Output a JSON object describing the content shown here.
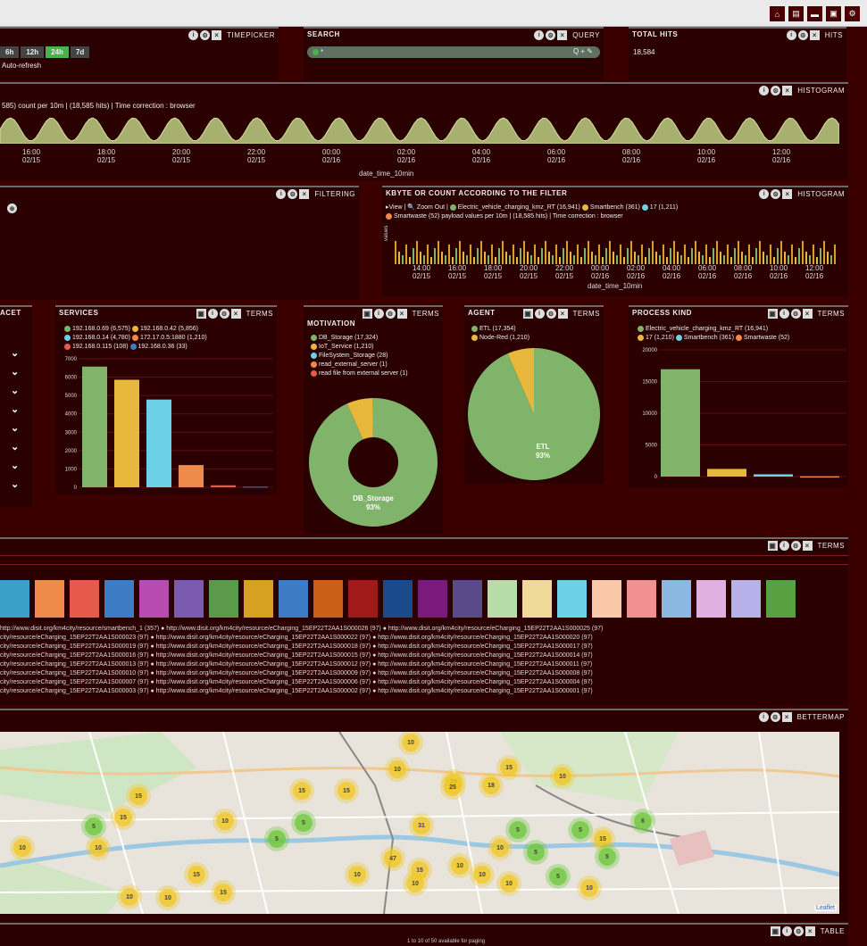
{
  "timepicker": {
    "title": "TIMEPICKER",
    "buttons": [
      "6h",
      "12h",
      "24h",
      "7d"
    ],
    "active": "24h",
    "autorefresh": "Auto-refresh"
  },
  "search": {
    "title": "SEARCH",
    "query_label": "QUERY",
    "value": "*",
    "icons": "Q + ✎"
  },
  "total_hits": {
    "title": "TOTAL HITS",
    "value": "18,584",
    "badge": "HITS"
  },
  "histogram1": {
    "badge": "HISTOGRAM",
    "caption": "585) count per 10m | (18,585 hits) | Time correction : browser",
    "xlabel": "date_time_10min",
    "ticks": [
      [
        "16:00",
        "02/15"
      ],
      [
        "18:00",
        "02/15"
      ],
      [
        "20:00",
        "02/15"
      ],
      [
        "22:00",
        "02/15"
      ],
      [
        "00:00",
        "02/16"
      ],
      [
        "02:00",
        "02/16"
      ],
      [
        "04:00",
        "02/16"
      ],
      [
        "06:00",
        "02/16"
      ],
      [
        "08:00",
        "02/16"
      ],
      [
        "10:00",
        "02/16"
      ],
      [
        "12:00",
        "02/16"
      ]
    ]
  },
  "filtering": {
    "badge": "FILTERING"
  },
  "histogram2": {
    "title": "KBYTE OR COUNT ACCORDING TO THE FILTER",
    "badge": "HISTOGRAM",
    "view": "▸View | 🔍 Zoom Out |",
    "legend1": "Electric_vehicle_charging_kmz_RT (16,941)",
    "legend2": "Smartbench (361)",
    "legend3": "17 (1,211)",
    "legend4": "Smartwaste (52)",
    "caption": "payload values per 10m | (18,585 hits) | Time correction : browser",
    "xlabel": "date_time_10min",
    "ylabel": "values",
    "ticks": [
      [
        "14:00",
        "02/15"
      ],
      [
        "16:00",
        "02/15"
      ],
      [
        "18:00",
        "02/15"
      ],
      [
        "20:00",
        "02/15"
      ],
      [
        "22:00",
        "02/15"
      ],
      [
        "00:00",
        "02/16"
      ],
      [
        "02:00",
        "02/16"
      ],
      [
        "04:00",
        "02/16"
      ],
      [
        "06:00",
        "02/16"
      ],
      [
        "08:00",
        "02/16"
      ],
      [
        "10:00",
        "02/16"
      ],
      [
        "12:00",
        "02/16"
      ]
    ]
  },
  "facet": {
    "title": "ACET"
  },
  "services": {
    "title": "SERVICES",
    "badge": "TERMS",
    "legend": [
      {
        "label": "192.168.0.69 (6,575)",
        "color": "#7fb46a"
      },
      {
        "label": "192.168.0.42 (5,856)",
        "color": "#e8b83c"
      },
      {
        "label": "192.168.0.14 (4,780)",
        "color": "#6cd0e6"
      },
      {
        "label": "172.17.0.5:1880 (1,210)",
        "color": "#ef8a4a"
      },
      {
        "label": "192.168.0.115 (108)",
        "color": "#e55a4a"
      },
      {
        "label": "192.168.0.36 (33)",
        "color": "#3d7bc4"
      }
    ],
    "yticks": [
      "7000",
      "6000",
      "5000",
      "4000",
      "3000",
      "2000",
      "1000",
      "0"
    ]
  },
  "motivation": {
    "title": "MOTIVATION",
    "badge": "TERMS",
    "legend": [
      {
        "label": "DB_Storage (17,324)",
        "color": "#7fb46a"
      },
      {
        "label": "IoT_Service (1,210)",
        "color": "#e8b83c"
      },
      {
        "label": "FileSystem_Storage (28)",
        "color": "#6cd0e6"
      },
      {
        "label": "read_external_server (1)",
        "color": "#ef8a4a"
      },
      {
        "label": "read file from external server (1)",
        "color": "#e55a4a"
      }
    ],
    "slice_label": "DB_Storage",
    "slice_pct": "93%"
  },
  "agent": {
    "title": "AGENT",
    "badge": "TERMS",
    "legend": [
      {
        "label": "ETL (17,354)",
        "color": "#7fb46a"
      },
      {
        "label": "Node-Red (1,210)",
        "color": "#e8b83c"
      }
    ],
    "slice_label": "ETL",
    "slice_pct": "93%"
  },
  "process_kind": {
    "title": "PROCESS KIND",
    "badge": "TERMS",
    "legend": [
      {
        "label": "Electric_vehicle_charging_kmz_RT (16,941)",
        "color": "#7fb46a"
      },
      {
        "label": "17 (1,210)",
        "color": "#e8b83c"
      },
      {
        "label": "Smartbench (361)",
        "color": "#6cd0e6"
      },
      {
        "label": "Smartwaste (52)",
        "color": "#ef8a4a"
      }
    ],
    "yticks": [
      "20000",
      "15000",
      "10000",
      "5000",
      "0"
    ]
  },
  "terms_panel": {
    "badge": "TERMS",
    "swatches": [
      "#3ba0c8",
      "#ef8a4a",
      "#e55a4a",
      "#3d7bc4",
      "#b84bb0",
      "#7a5bb0",
      "#5a9a4a",
      "#d8a020",
      "#3d7bc4",
      "#c8601a",
      "#a01a1a",
      "#1a4a8a",
      "#7a1a7a",
      "#5a4a8a",
      "#b8dca8",
      "#f0d898",
      "#6cd0e6",
      "#f8c8a8",
      "#f09090",
      "#8ab8e0",
      "#e0b0e0",
      "#b8b0e8",
      "#5aa040"
    ],
    "lines": [
      "http://www.disit.org/km4city/resource/smartbench_1 (357) ● http://www.disit.org/km4city/resource/eCharging_15EP22T2AA1S000026 (97) ● http://www.disit.org/km4city/resource/eCharging_15EP22T2AA1S000025 (97)",
      "city/resource/eCharging_15EP22T2AA1S000023 (97) ● http://www.disit.org/km4city/resource/eCharging_15EP22T2AA1S000022 (97) ● http://www.disit.org/km4city/resource/eCharging_15EP22T2AA1S000020 (97)",
      "city/resource/eCharging_15EP22T2AA1S000019 (97) ● http://www.disit.org/km4city/resource/eCharging_15EP22T2AA1S000018 (97) ● http://www.disit.org/km4city/resource/eCharging_15EP22T2AA1S000017 (97)",
      "city/resource/eCharging_15EP22T2AA1S000016 (97) ● http://www.disit.org/km4city/resource/eCharging_15EP22T2AA1S000015 (97) ● http://www.disit.org/km4city/resource/eCharging_15EP22T2AA1S000014 (97)",
      "city/resource/eCharging_15EP22T2AA1S000013 (97) ● http://www.disit.org/km4city/resource/eCharging_15EP22T2AA1S000012 (97) ● http://www.disit.org/km4city/resource/eCharging_15EP22T2AA1S000011 (97)",
      "city/resource/eCharging_15EP22T2AA1S000010 (97) ● http://www.disit.org/km4city/resource/eCharging_15EP22T2AA1S000009 (97) ● http://www.disit.org/km4city/resource/eCharging_15EP22T2AA1S000008 (97)",
      "city/resource/eCharging_15EP22T2AA1S000007 (97) ● http://www.disit.org/km4city/resource/eCharging_15EP22T2AA1S000006 (97) ● http://www.disit.org/km4city/resource/eCharging_15EP22T2AA1S000004 (97)",
      "city/resource/eCharging_15EP22T2AA1S000003 (97) ● http://www.disit.org/km4city/resource/eCharging_15EP22T2AA1S000002 (97) ● http://www.disit.org/km4city/resource/eCharging_15EP22T2AA1S000001 (97)"
    ]
  },
  "bettermap": {
    "badge": "BETTERMAP",
    "attribution": "Leaflet",
    "clusters": [
      "10",
      "15",
      "10",
      "15",
      "28",
      "18",
      "15",
      "10",
      "15",
      "5",
      "10",
      "5",
      "15",
      "5",
      "31",
      "5",
      "10",
      "6",
      "5",
      "10",
      "15",
      "47",
      "10",
      "10",
      "10",
      "25",
      "5",
      "15",
      "15",
      "10",
      "10",
      "5",
      "10",
      "5",
      "10",
      "15",
      "10",
      "10"
    ]
  },
  "table": {
    "badge": "TABLE",
    "footer": "1 to 10 of 50 available for paging"
  },
  "chart_data": [
    {
      "type": "bar",
      "title": "SERVICES",
      "categories": [
        "192.168.0.69",
        "192.168.0.42",
        "192.168.0.14",
        "172.17.0.5:1880",
        "192.168.0.115",
        "192.168.0.36"
      ],
      "values": [
        6575,
        5856,
        4780,
        1210,
        108,
        33
      ],
      "ylim": [
        0,
        7000
      ]
    },
    {
      "type": "pie",
      "title": "MOTIVATION",
      "categories": [
        "DB_Storage",
        "IoT_Service",
        "FileSystem_Storage",
        "read_external_server",
        "read file from external server"
      ],
      "values": [
        17324,
        1210,
        28,
        1,
        1
      ]
    },
    {
      "type": "pie",
      "title": "AGENT",
      "categories": [
        "ETL",
        "Node-Red"
      ],
      "values": [
        17354,
        1210
      ]
    },
    {
      "type": "bar",
      "title": "PROCESS KIND",
      "categories": [
        "Electric_vehicle_charging_kmz_RT",
        "17",
        "Smartbench",
        "Smartwaste"
      ],
      "values": [
        16941,
        1210,
        361,
        52
      ],
      "ylim": [
        0,
        20000
      ]
    }
  ]
}
